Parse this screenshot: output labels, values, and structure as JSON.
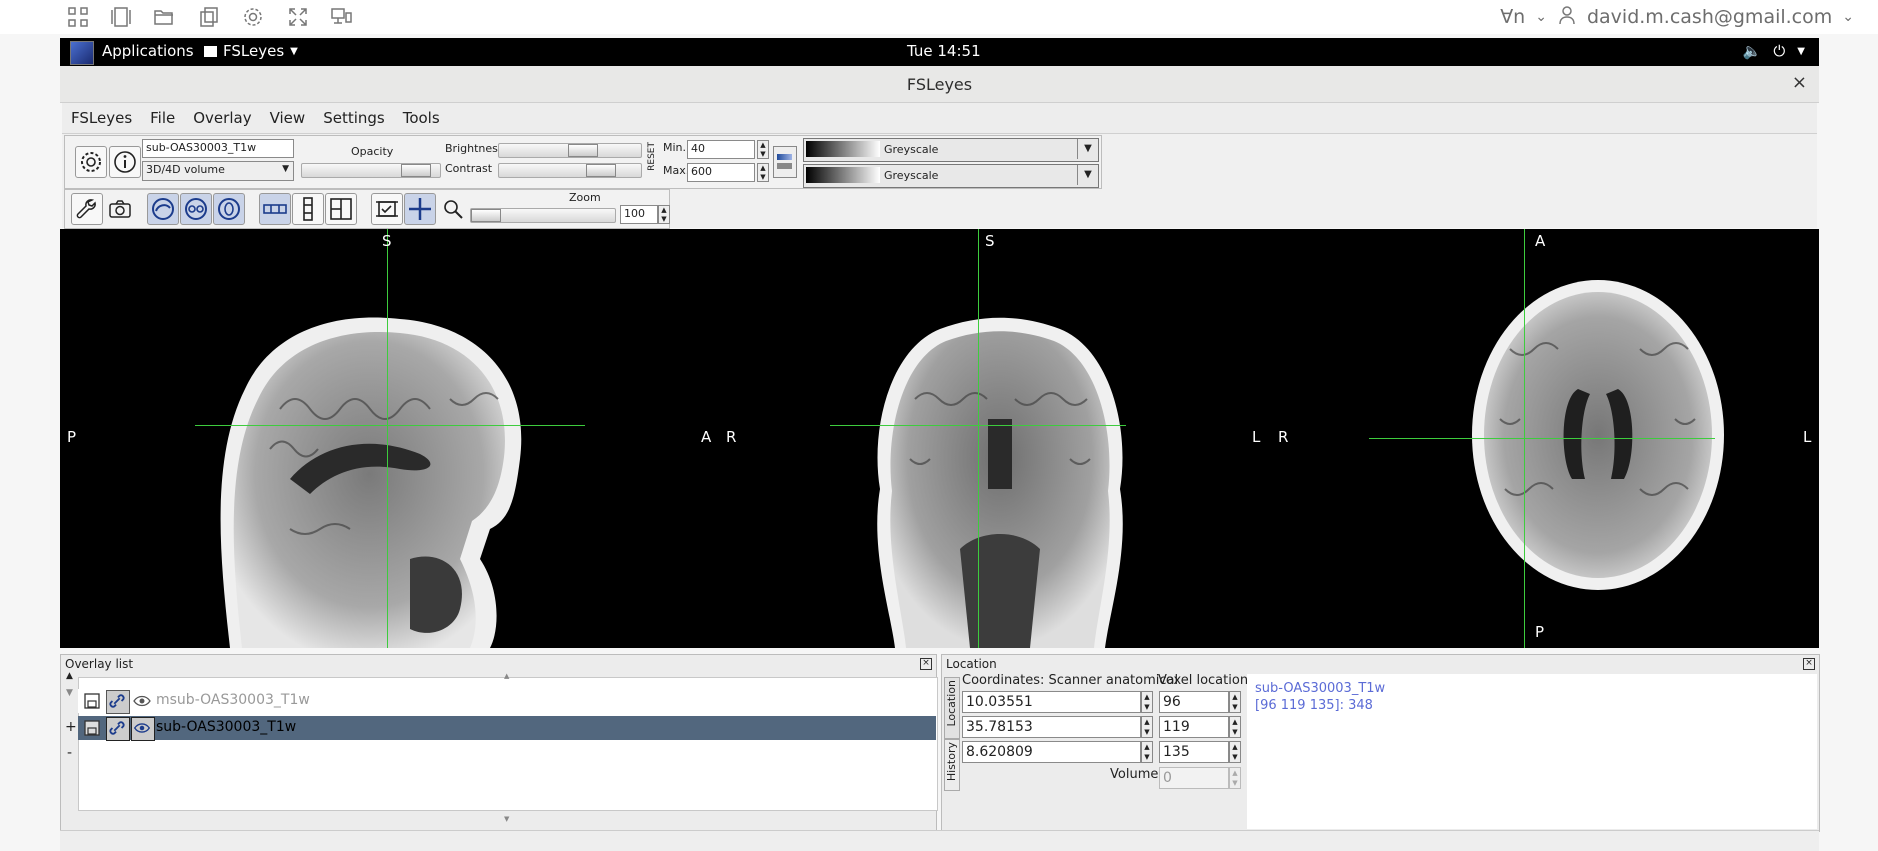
{
  "desktop": {
    "language_indicator": "∀n",
    "user": "david.m.cash@gmail.com",
    "apps_label": "Applications",
    "app_menu": "FSLeyes",
    "clock": "Tue 14:51"
  },
  "window": {
    "title": "FSLeyes",
    "close": "×"
  },
  "menu": [
    "FSLeyes",
    "File",
    "Overlay",
    "View",
    "Settings",
    "Tools"
  ],
  "overlay_toolbar": {
    "name_value": "sub-OAS30003_T1w",
    "type_value": "3D/4D volume",
    "opacity_label": "Opacity",
    "brightness_label": "Brightness",
    "contrast_label": "Contrast",
    "reset_label": "RESET",
    "min_label": "Min.",
    "min_value": "40",
    "max_label": "Max.",
    "max_value": "600",
    "cmap1": "Greyscale",
    "cmap2": "Greyscale",
    "brightness_level": 0.62,
    "contrast_level": 0.78,
    "opacity_level": 0.92
  },
  "ortho_toolbar": {
    "zoom_label": "Zoom",
    "zoom_value": "100",
    "zoom_level": 0.0
  },
  "views": {
    "sagittal": {
      "top": "S",
      "left": "P",
      "right": "A"
    },
    "coronal": {
      "top": "S",
      "left": "R",
      "right": "L"
    },
    "axial": {
      "top": "A",
      "left": "R",
      "right": "L",
      "bottom": "P"
    }
  },
  "overlay_list": {
    "title": "Overlay list",
    "items": [
      {
        "name": "msub-OAS30003_T1w",
        "selected": false
      },
      {
        "name": "sub-OAS30003_T1w",
        "selected": true
      }
    ],
    "controls": [
      "+",
      "-"
    ]
  },
  "location": {
    "title": "Location",
    "tab_location": "Location",
    "tab_history": "History",
    "coords_label": "Coordinates: Scanner anatomical",
    "voxel_label": "Voxel location",
    "coords": [
      "10.03551",
      "35.78153",
      "8.620809"
    ],
    "voxels": [
      "96",
      "119",
      "135"
    ],
    "volume_label": "Volume",
    "volume_value": "0",
    "info_name": "sub-OAS30003_T1w",
    "info_value": "[96 119 135]: 348"
  },
  "colors": {
    "crosshair": "#3dcc3d",
    "selection": "#52677e",
    "info_text": "#5b6bd6"
  }
}
